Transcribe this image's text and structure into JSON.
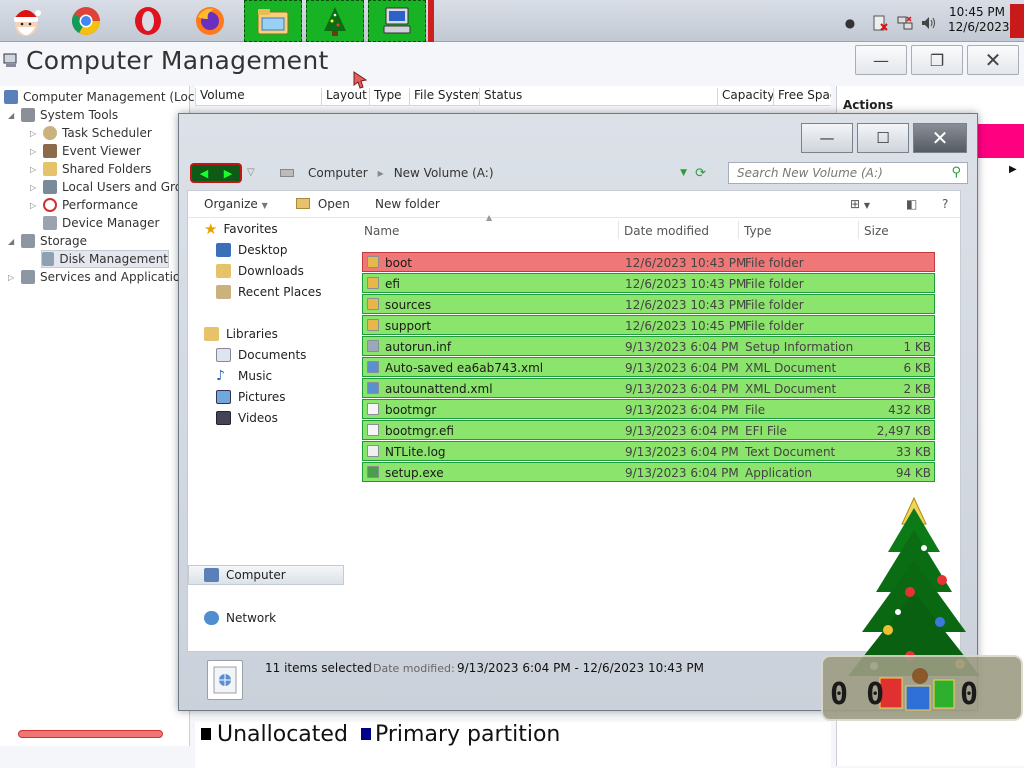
{
  "taskbar": {
    "apps": [
      {
        "name": "santa-app-icon"
      },
      {
        "name": "chrome-icon"
      },
      {
        "name": "opera-icon"
      },
      {
        "name": "firefox-icon"
      }
    ],
    "pinned": [
      {
        "name": "file-explorer-icon"
      },
      {
        "name": "xmas-tree-icon"
      },
      {
        "name": "computer-icon"
      }
    ],
    "clock": {
      "time": "10:45 PM",
      "date": "12/6/2023"
    }
  },
  "cm": {
    "title": "Computer Management",
    "tree": [
      {
        "label": "Computer Management (Local",
        "icon": "computer-management-icon"
      },
      {
        "label": "System Tools",
        "icon": "system-tools-icon"
      },
      {
        "label": "Task Scheduler",
        "icon": "task-scheduler-icon"
      },
      {
        "label": "Event Viewer",
        "icon": "event-viewer-icon"
      },
      {
        "label": "Shared Folders",
        "icon": "shared-folders-icon"
      },
      {
        "label": "Local Users and Group",
        "icon": "users-icon"
      },
      {
        "label": "Performance",
        "icon": "performance-icon"
      },
      {
        "label": "Device Manager",
        "icon": "device-manager-icon"
      },
      {
        "label": "Storage",
        "icon": "storage-icon"
      },
      {
        "label": "Disk Management",
        "icon": "disk-icon"
      },
      {
        "label": "Services and Applications",
        "icon": "services-icon"
      }
    ],
    "volume_columns": [
      "Volume",
      "Layout",
      "Type",
      "File System",
      "Status",
      "Capacity",
      "Free Spac"
    ],
    "actions_title": "Actions",
    "legend": [
      "Unallocated",
      "Primary partition"
    ],
    "legend_colors": [
      "#000000",
      "#00008b"
    ]
  },
  "explorer": {
    "address": [
      "Computer",
      "New Volume (A:)"
    ],
    "search_placeholder": "Search New Volume (A:)",
    "toolbar": {
      "organize": "Organize",
      "open": "Open",
      "new_folder": "New folder"
    },
    "nav": {
      "favorites": "Favorites",
      "favorites_items": [
        "Desktop",
        "Downloads",
        "Recent Places"
      ],
      "libraries": "Libraries",
      "libraries_items": [
        "Documents",
        "Music",
        "Pictures",
        "Videos"
      ],
      "computer": "Computer",
      "network": "Network"
    },
    "columns": {
      "name": "Name",
      "date": "Date modified",
      "type": "Type",
      "size": "Size"
    },
    "files": [
      {
        "name": "boot",
        "date": "12/6/2023 10:43 PM",
        "type": "File folder",
        "size": "",
        "icon": "folder-icon"
      },
      {
        "name": "efi",
        "date": "12/6/2023 10:43 PM",
        "type": "File folder",
        "size": "",
        "icon": "folder-icon"
      },
      {
        "name": "sources",
        "date": "12/6/2023 10:43 PM",
        "type": "File folder",
        "size": "",
        "icon": "folder-icon"
      },
      {
        "name": "support",
        "date": "12/6/2023 10:45 PM",
        "type": "File folder",
        "size": "",
        "icon": "folder-icon"
      },
      {
        "name": "autorun.inf",
        "date": "9/13/2023 6:04 PM",
        "type": "Setup Information",
        "size": "1 KB",
        "icon": "settings-file-icon"
      },
      {
        "name": "Auto-saved ea6ab743.xml",
        "date": "9/13/2023 6:04 PM",
        "type": "XML Document",
        "size": "6 KB",
        "icon": "xml-file-icon"
      },
      {
        "name": "autounattend.xml",
        "date": "9/13/2023 6:04 PM",
        "type": "XML Document",
        "size": "2 KB",
        "icon": "xml-file-icon"
      },
      {
        "name": "bootmgr",
        "date": "9/13/2023 6:04 PM",
        "type": "File",
        "size": "432 KB",
        "icon": "file-icon"
      },
      {
        "name": "bootmgr.efi",
        "date": "9/13/2023 6:04 PM",
        "type": "EFI File",
        "size": "2,497 KB",
        "icon": "file-icon"
      },
      {
        "name": "NTLite.log",
        "date": "9/13/2023 6:04 PM",
        "type": "Text Document",
        "size": "33 KB",
        "icon": "text-file-icon"
      },
      {
        "name": "setup.exe",
        "date": "9/13/2023 6:04 PM",
        "type": "Application",
        "size": "94 KB",
        "icon": "setup-app-icon"
      }
    ],
    "details": {
      "count": "11 items selected",
      "date_label": "Date modified:",
      "date_value": "9/13/2023 6:04 PM - 12/6/2023 10:43 PM"
    }
  },
  "colors": {
    "row_highlight": "#8be46b",
    "row_selected": "#ef7777",
    "pinned_green": "#17b324",
    "actions_accent": "#ff0080"
  }
}
